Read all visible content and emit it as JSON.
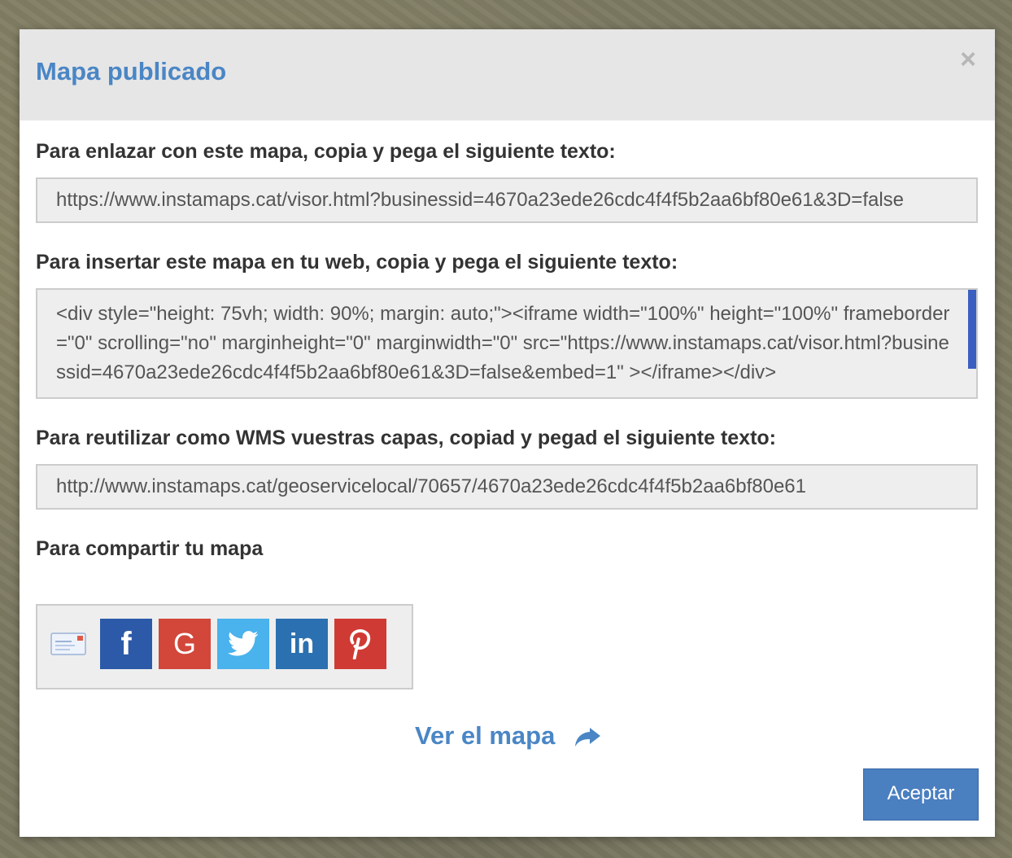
{
  "modal": {
    "title": "Mapa publicado",
    "close_glyph": "×"
  },
  "link_section": {
    "label": "Para enlazar con este mapa, copia y pega el siguiente texto:",
    "value": "https://www.instamaps.cat/visor.html?businessid=4670a23ede26cdc4f4f5b2aa6bf80e61&3D=false"
  },
  "embed_section": {
    "label": "Para insertar este mapa en tu web, copia y pega el siguiente texto:",
    "value": "<div style=\"height: 75vh; width: 90%; margin: auto;\"><iframe width=\"100%\" height=\"100%\" frameborder=\"0\" scrolling=\"no\" marginheight=\"0\" marginwidth=\"0\" src=\"https://www.instamaps.cat/visor.html?businessid=4670a23ede26cdc4f4f5b2aa6bf80e61&3D=false&embed=1\" ></iframe></div>"
  },
  "wms_section": {
    "label": "Para reutilizar como WMS vuestras capas, copiad y pegad el siguiente texto:",
    "value": "http://www.instamaps.cat/geoservicelocal/70657/4670a23ede26cdc4f4f5b2aa6bf80e61"
  },
  "share_section": {
    "label": "Para compartir tu mapa",
    "icons": [
      {
        "name": "email-icon",
        "color": "#f2f2f2"
      },
      {
        "name": "facebook-icon",
        "glyph": "f",
        "color": "#2d5aa8"
      },
      {
        "name": "google-icon",
        "glyph": "G",
        "color": "#d2473a"
      },
      {
        "name": "twitter-icon",
        "color": "#4ab2ec"
      },
      {
        "name": "linkedin-icon",
        "glyph": "in",
        "color": "#2b70b0"
      },
      {
        "name": "pinterest-icon",
        "glyph": "P",
        "color": "#d03a34"
      }
    ]
  },
  "view_link": {
    "label": "Ver el mapa",
    "icon": "share-arrow-icon"
  },
  "footer": {
    "accept_label": "Aceptar"
  },
  "colors": {
    "accent": "#4a86c5",
    "header_bg": "#e6e6e6",
    "button_bg": "#4a7fc0"
  }
}
